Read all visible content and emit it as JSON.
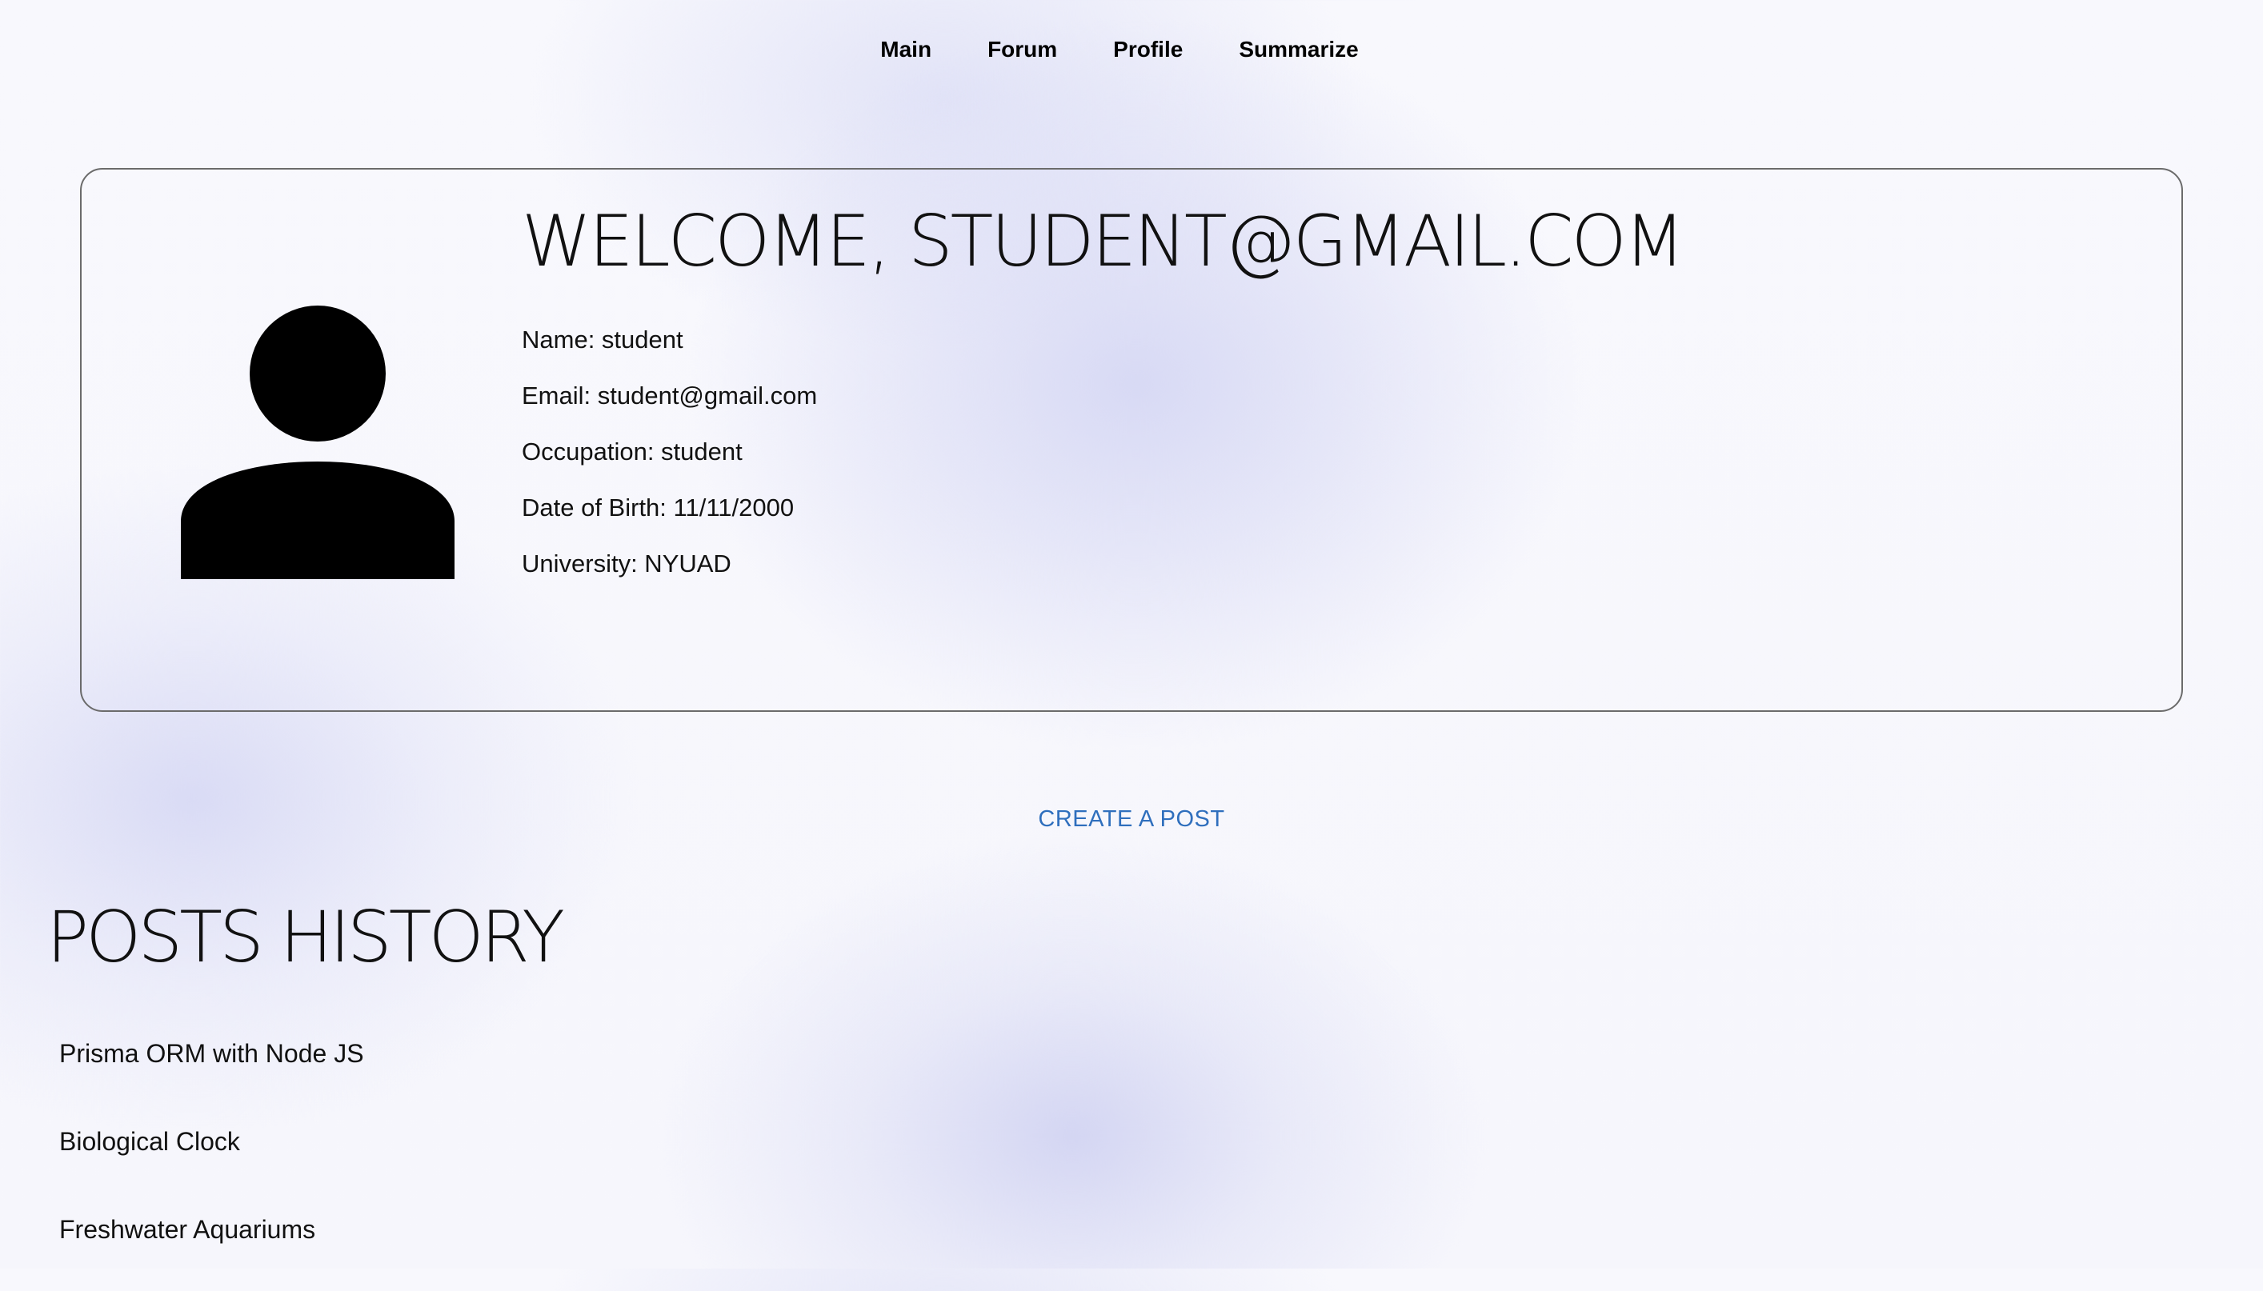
{
  "nav": {
    "items": [
      {
        "label": "Main"
      },
      {
        "label": "Forum"
      },
      {
        "label": "Profile"
      },
      {
        "label": "Summarize"
      }
    ]
  },
  "profile": {
    "welcome": "WELCOME, STUDENT@GMAIL.COM",
    "avatar_icon": "user-avatar-icon",
    "fields": [
      {
        "text": "Name: student"
      },
      {
        "text": "Email: student@gmail.com"
      },
      {
        "text": "Occupation: student"
      },
      {
        "text": "Date of Birth: 11/11/2000"
      },
      {
        "text": "University: NYUAD"
      }
    ]
  },
  "actions": {
    "create_post_label": "CREATE A POST"
  },
  "posts": {
    "title": "POSTS HISTORY",
    "items": [
      {
        "title": "Prisma ORM with Node JS"
      },
      {
        "title": "Biological Clock"
      },
      {
        "title": "Freshwater Aquariums"
      }
    ]
  },
  "colors": {
    "link": "#2f6fbd",
    "card_border": "#6b6b6b",
    "background_tint": "#d6d8f4"
  }
}
